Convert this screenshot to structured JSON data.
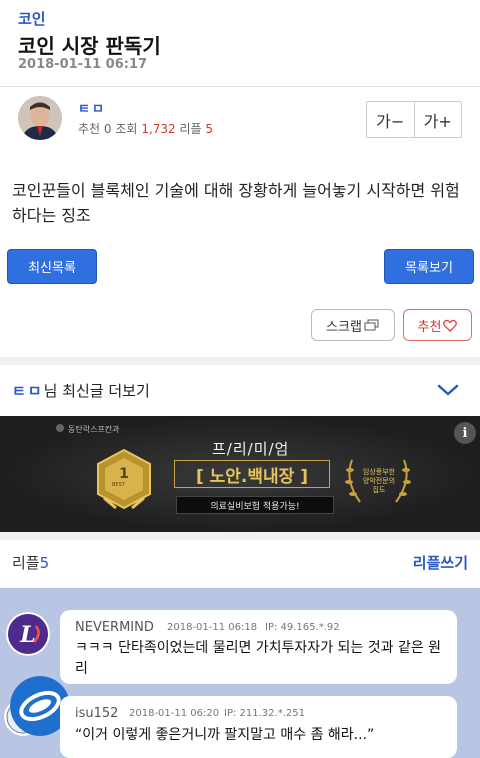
{
  "post": {
    "category": "코인",
    "title": "코인 시장 판독기",
    "date": "2018-01-11 06:17",
    "author": "ㅌㅁ",
    "recommend_label": "추천",
    "recommend_count": "0",
    "views_label": "조회",
    "views_count": "1,732",
    "reply_label": "리플",
    "reply_count": "5",
    "font_smaller": "가−",
    "font_larger": "가+",
    "content": "코인꾼들이 블록체인 기술에 대해 장황하게 늘어놓기 시작하면 위험하다는 징조"
  },
  "buttons": {
    "latest": "최신목록",
    "list": "목록보기",
    "scrap": "스크랩",
    "recommend": "추천"
  },
  "more": {
    "author": "ㅌㅁ",
    "suffix": "님 최신글 더보기"
  },
  "ad": {
    "company": "동탄락스프칸과",
    "premium": "프/리/미/엄",
    "brand": "[ 노안.백내장 ]",
    "sub": "의료실비보험 적용가능!",
    "badge_left": "BEST",
    "badge_right": "임상풍부한 양악전문의 집도",
    "info": "i"
  },
  "replies": {
    "label": "리플",
    "count": "5",
    "write": "리플쓰기",
    "items": [
      {
        "nick": "NEVERMIND",
        "date": "2018-01-11 06:18",
        "ip": "IP: 49.165.*.92",
        "text": "ㅋㅋㅋ 단타족이었는데 물리면 가치투자자가 되는 것과 같은 원리"
      },
      {
        "nick": "isu152",
        "date": "2018-01-11 06:20",
        "ip": "IP: 211.32.*.251",
        "text": "“이거 이렇게 좋은거니까 팔지말고 매수 좀 해라...”"
      }
    ]
  },
  "colors": {
    "accent": "#2a56c6",
    "button_blue": "#2f6fe0",
    "red": "#d9342b",
    "comment_bg": "#b8c6e4"
  }
}
